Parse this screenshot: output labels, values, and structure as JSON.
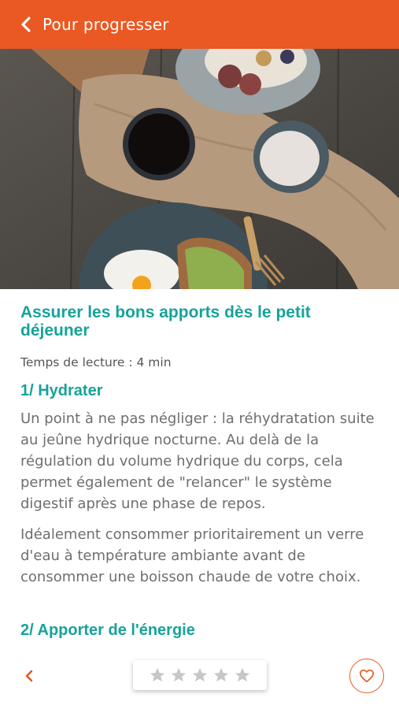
{
  "header": {
    "back_label": "Pour progresser",
    "back_icon": "chevron-left-icon",
    "background": "#ea5823"
  },
  "article": {
    "title": "Assurer les bons apports dès le petit déjeuner",
    "reading_time": "Temps de lecture : 4 min",
    "sections": [
      {
        "heading": "1/ Hydrater",
        "paragraphs": [
          "Un point à ne pas négliger : la réhydratation suite au jeûne hydrique nocturne. Au delà de la régulation du volume hydrique du corps, cela permet également de \"relancer\" le système digestif après une phase de repos.",
          "Idéalement consommer prioritairement un verre d'eau à température ambiante avant de consommer une boisson chaude de votre choix."
        ]
      },
      {
        "heading": "2/ Apporter de l'énergie"
      }
    ],
    "accent_color": "#16a39a"
  },
  "footer": {
    "prev_icon": "chevron-left-icon",
    "rating": 0,
    "rating_max": 5,
    "star_color": "#c7c7c7",
    "favorite_icon": "heart-icon"
  }
}
